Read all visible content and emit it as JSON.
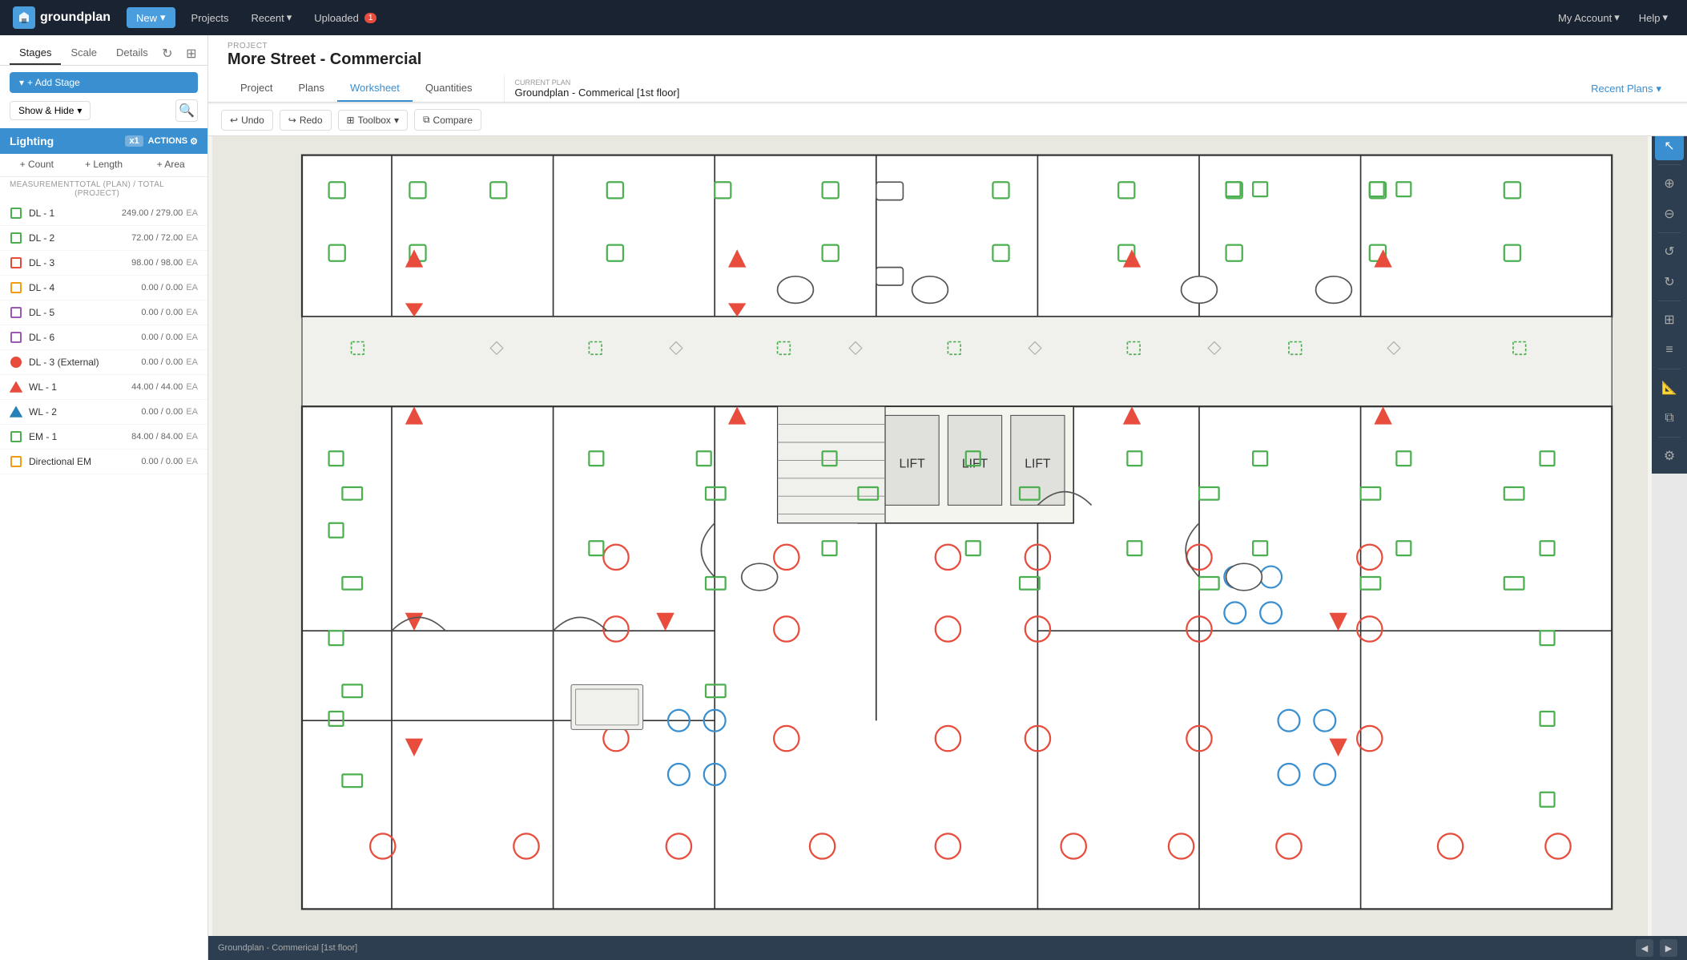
{
  "nav": {
    "logo_text": "groundplan",
    "new_label": "New",
    "new_dropdown": true,
    "projects_label": "Projects",
    "recent_label": "Recent",
    "recent_dropdown": true,
    "uploaded_label": "Uploaded",
    "uploaded_badge": "1",
    "my_account_label": "My Account",
    "my_account_dropdown": true,
    "help_label": "Help",
    "help_dropdown": true
  },
  "project": {
    "label": "PROJECT",
    "title": "More Street - Commercial",
    "tabs": [
      "Project",
      "Plans",
      "Worksheet",
      "Quantities"
    ],
    "active_tab": "Worksheet",
    "current_plan_label": "CURRENT PLAN",
    "current_plan_name": "Groundplan - Commerical [1st floor]",
    "recent_plans_label": "Recent Plans"
  },
  "toolbar": {
    "undo_label": "Undo",
    "redo_label": "Redo",
    "toolbox_label": "Toolbox",
    "compare_label": "Compare"
  },
  "sidebar": {
    "tabs": [
      "Stages",
      "Scale",
      "Details"
    ],
    "active_tab": "Stages",
    "add_stage_label": "+ Add Stage",
    "show_hide_label": "Show & Hide",
    "stage_name": "Lighting",
    "x_multiplier": "x1",
    "actions_label": "ACTIONS",
    "measure_tabs": [
      "+ Count",
      "+ Length",
      "+ Area"
    ],
    "measure_header_left": "MEASUREMENT",
    "measure_header_right": "TOTAL (PLAN) / TOTAL (PROJECT)",
    "items": [
      {
        "name": "DL - 1",
        "color": "#4CAF50",
        "border_color": "#4CAF50",
        "shape": "square",
        "plan_count": "249.00",
        "project_count": "279.00",
        "unit": "EA"
      },
      {
        "name": "DL - 2",
        "color": "#4CAF50",
        "border_color": "#4CAF50",
        "shape": "square",
        "plan_count": "72.00",
        "project_count": "72.00",
        "unit": "EA"
      },
      {
        "name": "DL - 3",
        "color": "#e74c3c",
        "border_color": "#e74c3c",
        "shape": "square",
        "plan_count": "98.00",
        "project_count": "98.00",
        "unit": "EA"
      },
      {
        "name": "DL - 4",
        "color": "#f39c12",
        "border_color": "#f39c12",
        "shape": "square",
        "plan_count": "0.00",
        "project_count": "0.00",
        "unit": "EA"
      },
      {
        "name": "DL - 5",
        "color": "#9b59b6",
        "border_color": "#9b59b6",
        "shape": "square",
        "plan_count": "0.00",
        "project_count": "0.00",
        "unit": "EA"
      },
      {
        "name": "DL - 6",
        "color": "#9b59b6",
        "border_color": "#9b59b6",
        "shape": "square",
        "plan_count": "0.00",
        "project_count": "0.00",
        "unit": "EA"
      },
      {
        "name": "DL - 3 (External)",
        "color": "#e74c3c",
        "border_color": "#e74c3c",
        "shape": "circle",
        "plan_count": "0.00",
        "project_count": "0.00",
        "unit": "EA"
      },
      {
        "name": "WL - 1",
        "color": "#e74c3c",
        "border_color": "#e74c3c",
        "shape": "triangle",
        "plan_count": "44.00",
        "project_count": "44.00",
        "unit": "EA"
      },
      {
        "name": "WL - 2",
        "color": "#2980b9",
        "border_color": "#2980b9",
        "shape": "triangle",
        "plan_count": "0.00",
        "project_count": "0.00",
        "unit": "EA"
      },
      {
        "name": "EM - 1",
        "color": "#4CAF50",
        "border_color": "#4CAF50",
        "shape": "square",
        "plan_count": "84.00",
        "project_count": "84.00",
        "unit": "EA"
      },
      {
        "name": "Directional EM",
        "color": "#f39c12",
        "border_color": "#f39c12",
        "shape": "square",
        "plan_count": "0.00",
        "project_count": "0.00",
        "unit": "EA"
      }
    ]
  },
  "bottom_bar": {
    "plan_name": "Groundplan - Commerical [1st floor]"
  },
  "right_tools": [
    "cursor",
    "zoom-in",
    "zoom-out",
    "rotate-left",
    "rotate-right",
    "grid",
    "layers",
    "settings",
    "measure",
    "compare"
  ]
}
